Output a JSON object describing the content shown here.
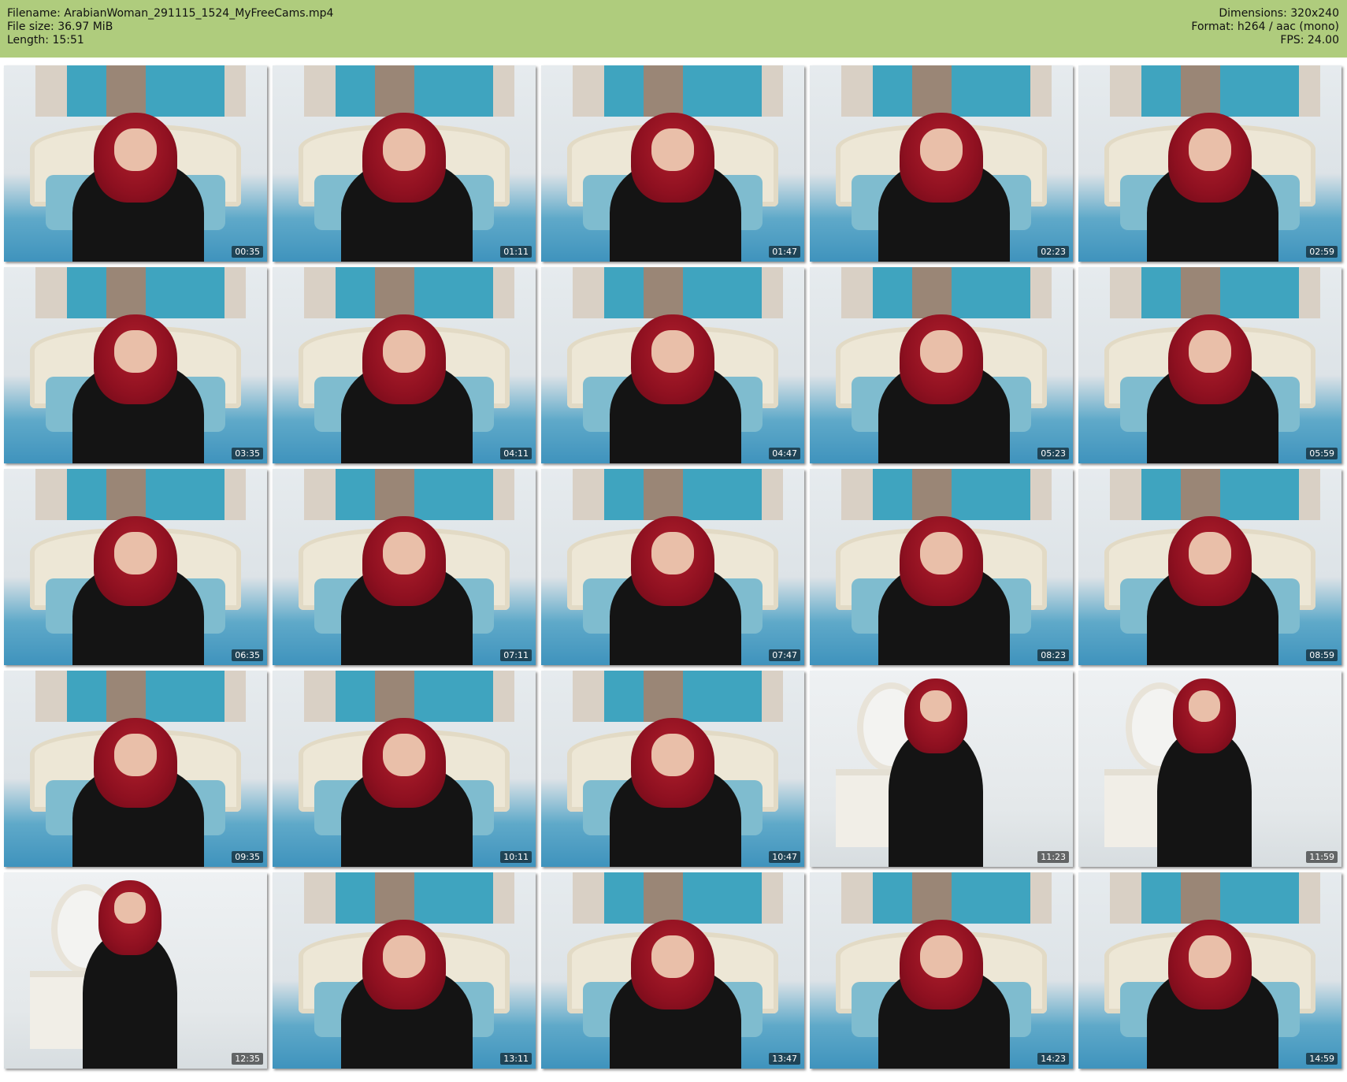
{
  "header": {
    "filename": "Filename: ArabianWoman_291115_1524_MyFreeCams.mp4",
    "filesize": "File size: 36.97 MiB",
    "length": "Length: 15:51",
    "dimensions": "Dimensions: 320x240",
    "format": "Format: h264 / aac (mono)",
    "fps": "FPS: 24.00"
  },
  "thumbnails": [
    "00:35",
    "01:11",
    "01:47",
    "02:23",
    "02:59",
    "03:35",
    "04:11",
    "04:47",
    "05:23",
    "05:59",
    "06:35",
    "07:11",
    "07:47",
    "08:23",
    "08:59",
    "09:35",
    "10:11",
    "10:47",
    "11:23",
    "11:59",
    "12:35",
    "13:11",
    "13:47",
    "14:23",
    "14:59"
  ],
  "colors": {
    "header_background": "#afcc7d",
    "timestamp_background": "#000000",
    "timestamp_text": "#ffffff"
  }
}
